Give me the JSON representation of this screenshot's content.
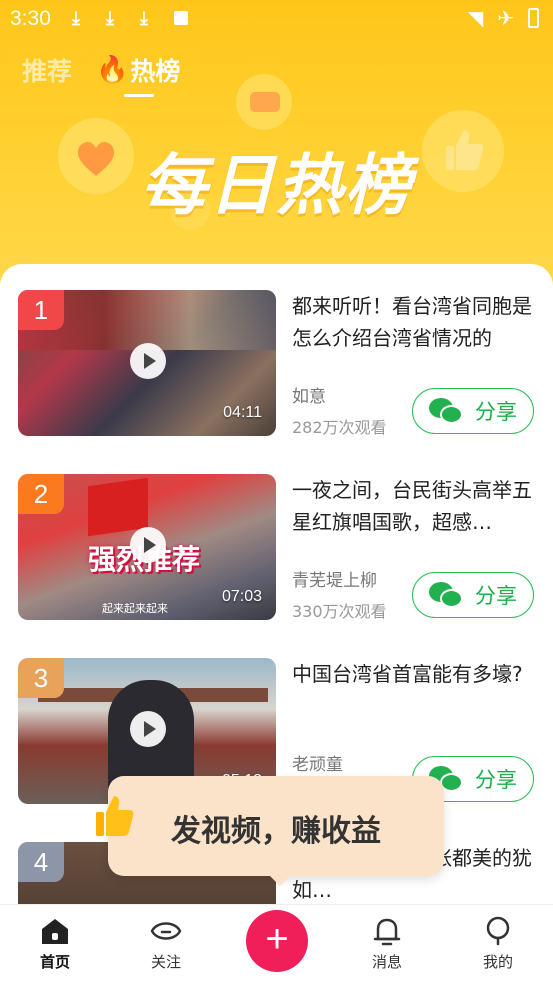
{
  "status_bar": {
    "time": "3:30"
  },
  "top_tabs": [
    {
      "label": "推荐"
    },
    {
      "label": "热榜"
    }
  ],
  "hero": {
    "title": "每日热榜"
  },
  "colors": {
    "accent": "#f01f5a",
    "share_green": "#1fae4d",
    "header": "#ffc61a"
  },
  "videos": [
    {
      "rank": "1",
      "rank_color": "#f04848",
      "title": "都来听听！看台湾省同胞是怎么介绍台湾省情况的",
      "author": "如意",
      "views": "282万次观看",
      "duration": "04:11",
      "share_label": "分享"
    },
    {
      "rank": "2",
      "rank_color": "#fb7a1e",
      "title": "一夜之间，台民街头高举五星红旗唱国歌，超感…",
      "author": "青芜堤上柳",
      "views": "330万次观看",
      "duration": "07:03",
      "share_label": "分享",
      "thumb_caption": "强烈推荐",
      "thumb_subtitle": "起来起来起来"
    },
    {
      "rank": "3",
      "rank_color": "#e8a25a",
      "title": "中国台湾省首富能有多壕?",
      "author": "老顽童",
      "views": "",
      "duration": "05:13",
      "share_label": "分享"
    },
    {
      "rank": "4",
      "rank_color": "#8d95a8",
      "title": "的圆明园，每一张都美的犹如…",
      "author": "",
      "views": "",
      "duration": "",
      "share_label": ""
    }
  ],
  "tooltip": {
    "text": "发视频，赚收益"
  },
  "bottom_nav": [
    {
      "label": "首页",
      "icon": "home-icon"
    },
    {
      "label": "关注",
      "icon": "eye-icon"
    },
    {
      "label": "+",
      "icon": "plus-icon"
    },
    {
      "label": "消息",
      "icon": "bell-icon"
    },
    {
      "label": "我的",
      "icon": "user-icon"
    }
  ]
}
